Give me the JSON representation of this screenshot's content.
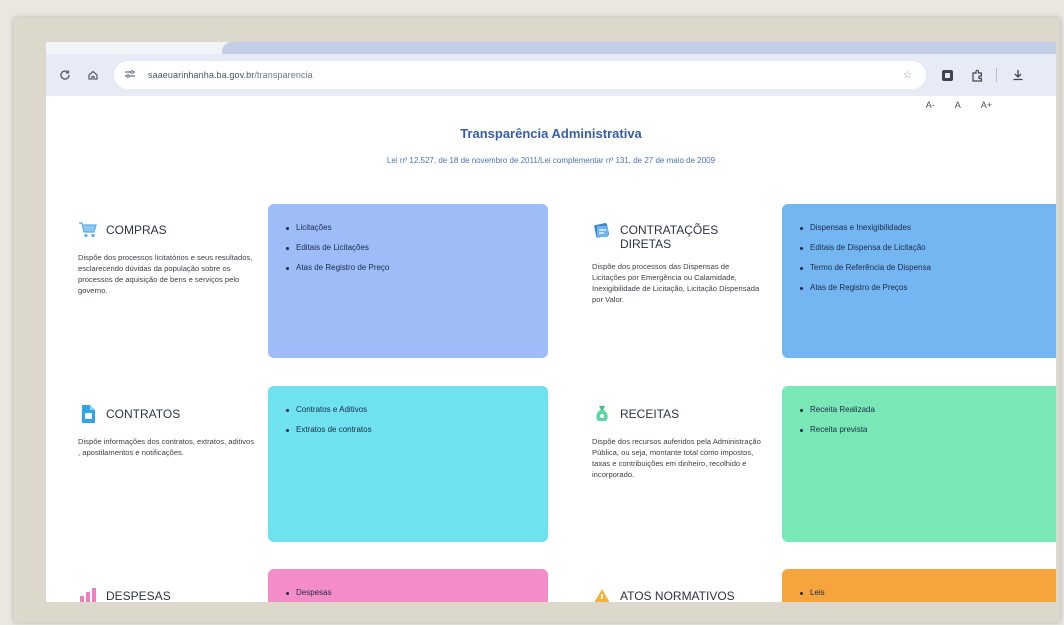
{
  "browser": {
    "url_host": "saaeuarinhanha.ba.gov.br",
    "url_path": "/transparencia"
  },
  "font_controls": {
    "decrease": "A-",
    "normal": "A",
    "increase": "A+"
  },
  "page": {
    "title": "Transparência Administrativa",
    "subtitle": "Lei nº 12.527, de 18 de novembro de 2011/Lei complementar nº 131, de 27 de maio de 2009"
  },
  "sections": {
    "compras": {
      "title": "COMPRAS",
      "icon": "shopping-cart-icon",
      "description": "Dispõe dos processos licitatórios e seus resultados, esclarecendo dúvidas da população sobre os processos de aquisição de bens e serviços pelo governo.",
      "links": [
        "Licitações",
        "Editais de Licitações",
        "Atas de Registro de Preço"
      ],
      "color": "#9dbcf8"
    },
    "contratacoes": {
      "title": "CONTRATAÇÕES DIRETAS",
      "icon": "document-stack-icon",
      "description": "Dispõe dos processos das Dispensas de Licitações por Emergência ou Calamidade, Inexigibilidade de Licitação, Licitação Dispensada por Valor.",
      "links": [
        "Dispensas e Inexigibilidades",
        "Editais de Dispensa de Licitação",
        "Termo de Referência de Dispensa",
        "Atas de Registro de Preços"
      ],
      "color": "#74b6f1"
    },
    "contratos": {
      "title": "CONTRATOS",
      "icon": "contract-file-icon",
      "description": "Dispõe informações dos contratos, extratos, aditivos , apostilamentos e notificações.",
      "links": [
        "Contratos e Aditivos",
        "Extratos de contratos"
      ],
      "color": "#6ee2ee"
    },
    "receitas": {
      "title": "RECEITAS",
      "icon": "money-bag-icon",
      "description": "Dispõe dos recursos auferidos pela Administração Pública, ou seja, montante total como impostos, taxas e contribuições em dinheiro, recolhido e incorporado.",
      "links": [
        "Receita Realizada",
        "Receita prevista"
      ],
      "color": "#79e8b6"
    },
    "despesas": {
      "title": "DESPESAS",
      "icon": "chart-icon",
      "links": [
        "Despesas"
      ],
      "color": "#f48cc8"
    },
    "atos": {
      "title": "ATOS NORMATIVOS",
      "icon": "warning-icon",
      "links": [
        "Leis"
      ],
      "color": "#f6a53e"
    }
  },
  "colors": {
    "accent_title": "#355ea3",
    "browser_toolbar": "#e6ebf5"
  }
}
